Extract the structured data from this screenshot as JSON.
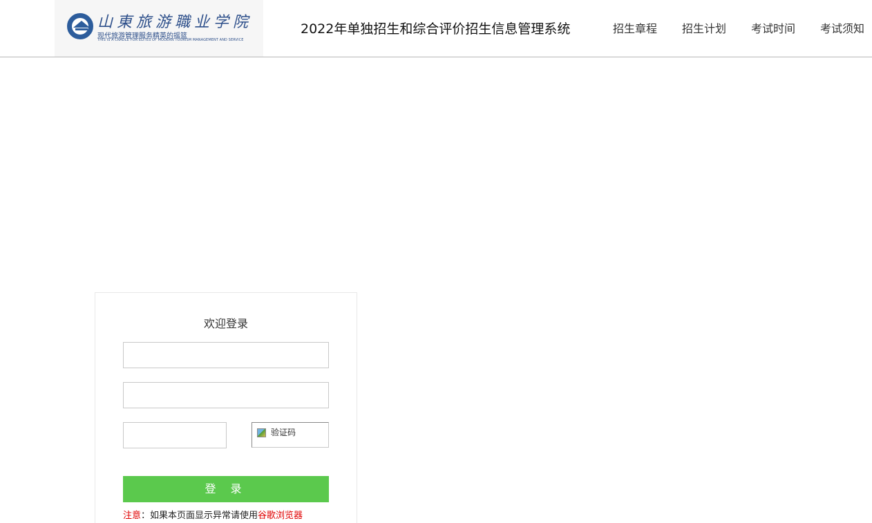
{
  "header": {
    "logo_name_cn": "山東旅游職业学院",
    "logo_slogan": "现代旅游管理服务精英的摇篮",
    "logo_en": "THIS IS A CRADLE FOR ELITES OF MODERN TOURISM MANAGEMENT AND SERVICE",
    "system_title": "2022年单独招生和综合评价招生信息管理系统",
    "nav": [
      "招生章程",
      "招生计划",
      "考试时间",
      "考试须知"
    ]
  },
  "login": {
    "title": "欢迎登录",
    "username": {
      "value": "",
      "placeholder": ""
    },
    "password": {
      "value": "",
      "placeholder": ""
    },
    "captcha_input": {
      "value": "",
      "placeholder": ""
    },
    "captcha_alt": "验证码",
    "submit_label": "登 录",
    "notice_prefix": "注意",
    "notice_text": "：如果本页面显示异常请使用",
    "notice_browser": "谷歌浏览器"
  },
  "colors": {
    "login_button": "#5bc94d",
    "notice_highlight": "#e00000",
    "logo_blue": "#2d4f8a"
  }
}
